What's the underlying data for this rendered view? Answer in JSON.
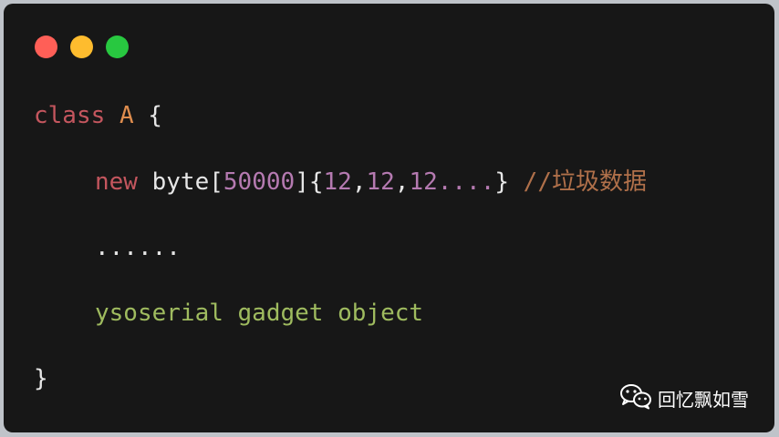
{
  "window": {
    "traffic_lights": [
      {
        "name": "close",
        "color": "#ff5f57"
      },
      {
        "name": "minimize",
        "color": "#febc2e"
      },
      {
        "name": "maximize",
        "color": "#28c840"
      }
    ]
  },
  "code": {
    "line1": {
      "keyword": "class",
      "name": "A",
      "brace": "{"
    },
    "line2": {
      "keyword": "new",
      "type": "byte[",
      "size": "50000",
      "open": "]{",
      "n1": "12",
      "c1": ",",
      "n2": "12",
      "c2": ",",
      "n3": "12....",
      "close": "}",
      "comment": "//垃圾数据"
    },
    "line3": "......",
    "line4": "ysoserial gadget object",
    "line5": "}"
  },
  "watermark": {
    "text": "回忆飘如雪",
    "icon": "wechat-icon"
  },
  "colors": {
    "background": "#171717",
    "keyword": "#c4565e",
    "class_name": "#df8d4e",
    "number": "#b57ab1",
    "comment": "#b0704a",
    "green_text": "#9fbb5f",
    "plain": "#e6e6e6"
  }
}
